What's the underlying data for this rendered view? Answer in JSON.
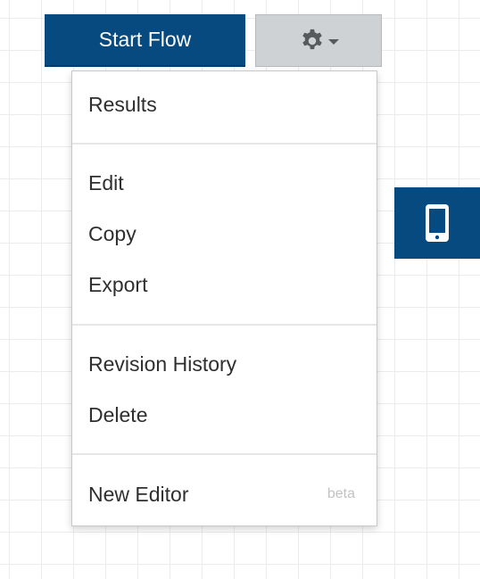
{
  "toolbar": {
    "start_flow_label": "Start Flow",
    "settings_icon": "gear-icon",
    "settings_caret_icon": "caret-down-icon"
  },
  "menu": {
    "sections": [
      {
        "items": [
          {
            "label": "Results"
          }
        ]
      },
      {
        "items": [
          {
            "label": "Edit"
          },
          {
            "label": "Copy"
          },
          {
            "label": "Export"
          }
        ]
      },
      {
        "items": [
          {
            "label": "Revision History"
          },
          {
            "label": "Delete"
          }
        ]
      },
      {
        "items": [
          {
            "label": "New Editor",
            "badge": "beta"
          }
        ]
      }
    ]
  },
  "side_button": {
    "icon": "mobile-phone-icon"
  },
  "colors": {
    "primary_blue": "#064a80",
    "settings_gray": "#cfd2d4",
    "icon_gray": "#555a5e",
    "badge_gray": "#c2c2c2",
    "text_dark": "#2f2f2f"
  }
}
